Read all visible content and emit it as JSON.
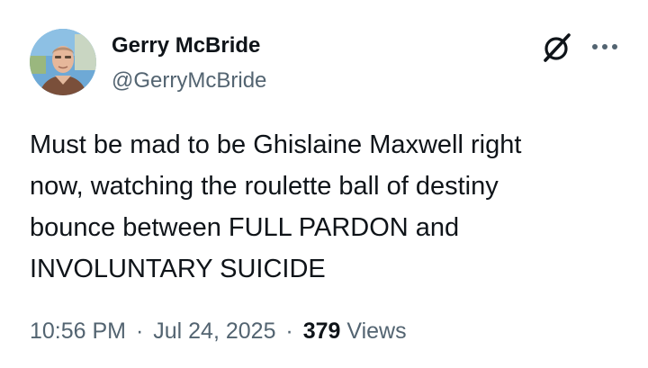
{
  "author": {
    "name": "Gerry McBride",
    "handle": "@GerryMcBride"
  },
  "tweet": {
    "text": "Must be mad to be Ghislaine Maxwell right\nnow, watching the roulette ball of destiny\nbounce between FULL PARDON and\nINVOLUNTARY SUICIDE"
  },
  "meta": {
    "time": "10:56 PM",
    "separator": "·",
    "date": "Jul 24, 2025",
    "views_count": "379",
    "views_label": "Views"
  },
  "icons": {
    "grok": "grok-icon",
    "more": "more-icon"
  },
  "colors": {
    "text": "#0f1419",
    "secondary": "#536471",
    "background": "#ffffff"
  }
}
